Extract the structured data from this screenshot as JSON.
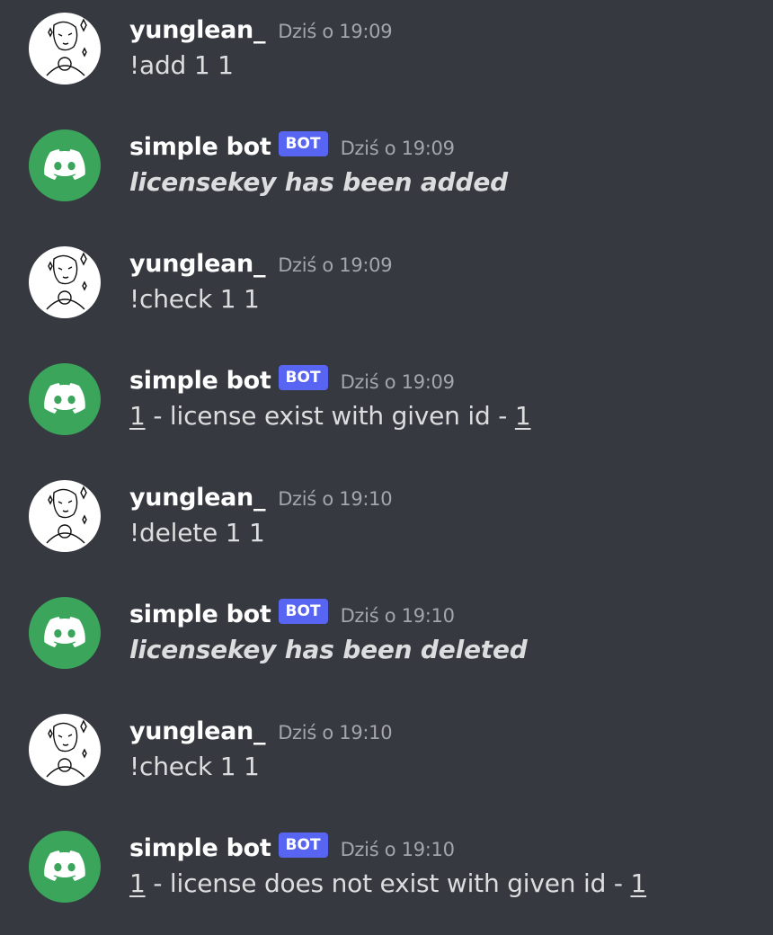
{
  "users": {
    "human": {
      "name": "yunglean_"
    },
    "bot": {
      "name": "simple bot",
      "tag": "BOT"
    }
  },
  "messages": [
    {
      "author": "yunglean_",
      "time": "Dziś o 19:09",
      "text": "!add 1 1"
    },
    {
      "author": "simple bot",
      "tag": "BOT",
      "time": "Dziś o 19:09",
      "text": "licensekey has been added"
    },
    {
      "author": "yunglean_",
      "time": "Dziś o 19:09",
      "text": "!check 1 1"
    },
    {
      "author": "simple bot",
      "tag": "BOT",
      "time": "Dziś o 19:09",
      "id1": "1",
      "mid": " - license exist with given id - ",
      "id2": "1"
    },
    {
      "author": "yunglean_",
      "time": "Dziś o 19:10",
      "text": "!delete 1 1"
    },
    {
      "author": "simple bot",
      "tag": "BOT",
      "time": "Dziś o 19:10",
      "text": "licensekey has been deleted"
    },
    {
      "author": "yunglean_",
      "time": "Dziś o 19:10",
      "text": "!check 1 1"
    },
    {
      "author": "simple bot",
      "tag": "BOT",
      "time": "Dziś o 19:10",
      "id1": "1",
      "mid": " - license does not exist with given id - ",
      "id2": "1"
    }
  ],
  "colors": {
    "background": "#36393f",
    "bot_tag": "#5865f2",
    "bot_avatar": "#3ba55c",
    "username": "#ffffff",
    "timestamp": "#a3a6aa",
    "text": "#dcddde"
  }
}
